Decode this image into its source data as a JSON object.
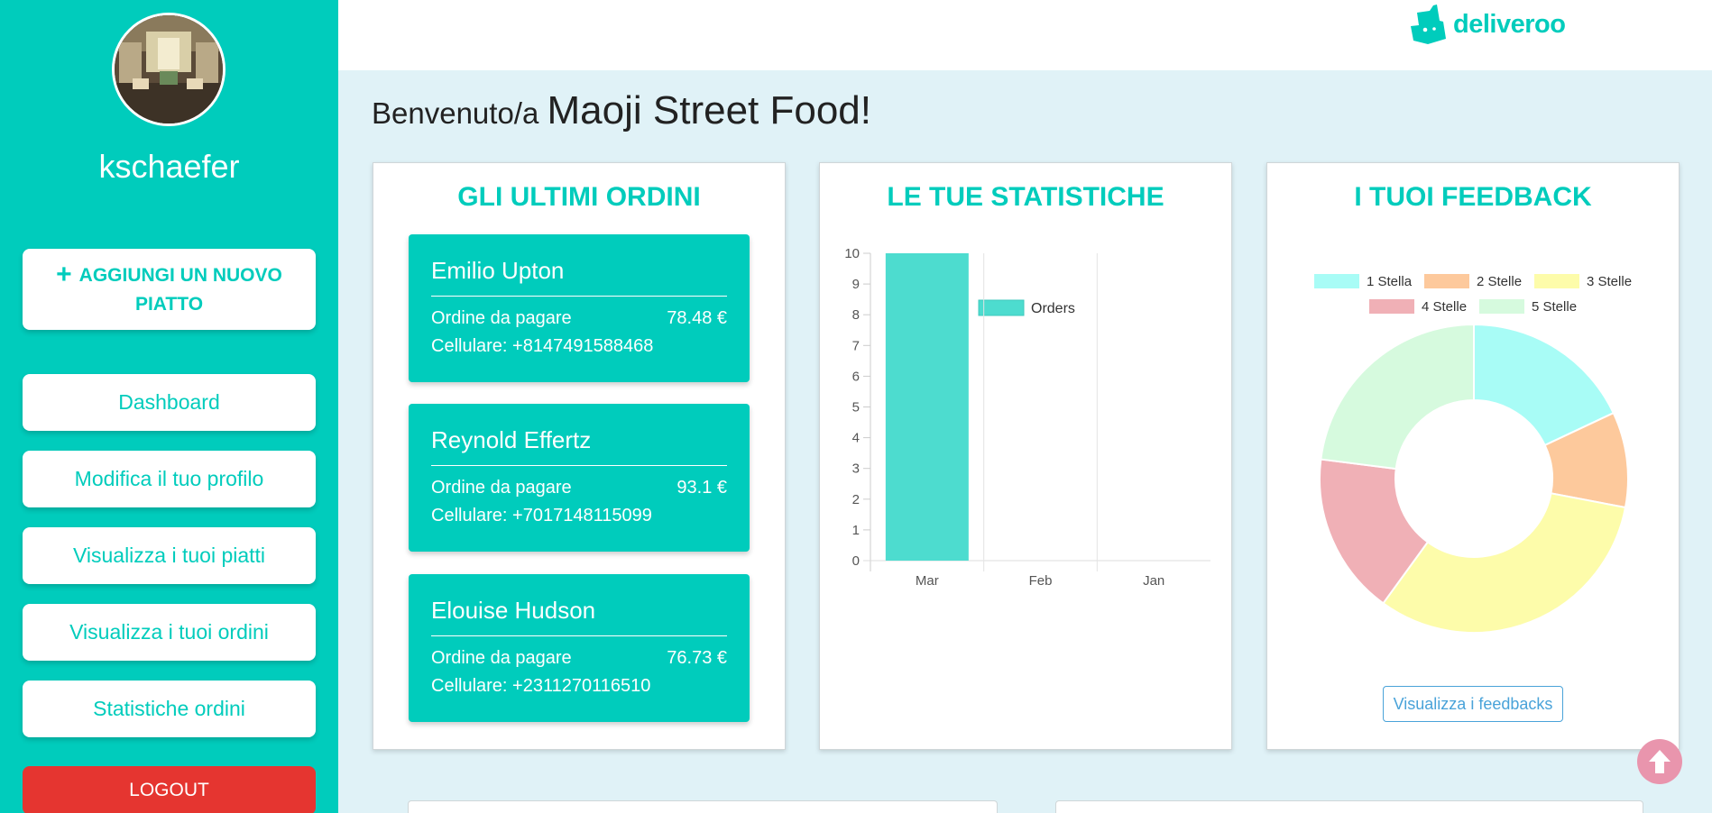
{
  "sidebar": {
    "username": "kschaefer",
    "add_button": {
      "line1": "AGGIUNGI UN NUOVO",
      "line2": "PIATTO"
    },
    "nav": [
      "Dashboard",
      "Modifica il tuo profilo",
      "Visualizza i tuoi piatti",
      "Visualizza i tuoi ordini",
      "Statistiche ordini"
    ],
    "logout": "LOGOUT"
  },
  "header": {
    "brand": "deliveroo"
  },
  "welcome": {
    "prefix": "Benvenuto/a",
    "name": "Maoji Street Food!"
  },
  "orders": {
    "title": "GLI ULTIMI ORDINI",
    "items": [
      {
        "name": "Emilio Upton",
        "status": "Ordine da pagare",
        "amount": "78.48 €",
        "phone": "Cellulare: +8147491588468"
      },
      {
        "name": "Reynold Effertz",
        "status": "Ordine da pagare",
        "amount": "93.1 €",
        "phone": "Cellulare: +7017148115099"
      },
      {
        "name": "Elouise Hudson",
        "status": "Ordine da pagare",
        "amount": "76.73 €",
        "phone": "Cellulare: +2311270116510"
      }
    ]
  },
  "stats": {
    "title": "LE TUE STATISTICHE",
    "chart_data": {
      "type": "bar",
      "categories": [
        "Mar",
        "Feb",
        "Jan"
      ],
      "series": [
        {
          "name": "Orders",
          "values": [
            10,
            0,
            0
          ]
        }
      ],
      "ylim": [
        0,
        10
      ],
      "yticks": [
        "0",
        "1",
        "2",
        "3",
        "4",
        "5",
        "6",
        "7",
        "8",
        "9",
        "10"
      ],
      "color": "#4ddccf",
      "legend": "top"
    }
  },
  "feedback": {
    "title": "I TUOI FEEDBACK",
    "button": "Visualizza i feedbacks",
    "chart_data": {
      "type": "pie",
      "labels": [
        "1 Stella",
        "2 Stelle",
        "3 Stelle",
        "4 Stelle",
        "5 Stelle"
      ],
      "values": [
        18,
        10,
        32,
        17,
        23
      ],
      "colors": [
        "#a8fcf6",
        "#fdc99c",
        "#fdfcaa",
        "#f0b0b6",
        "#d6fade"
      ],
      "legend": "top"
    }
  }
}
